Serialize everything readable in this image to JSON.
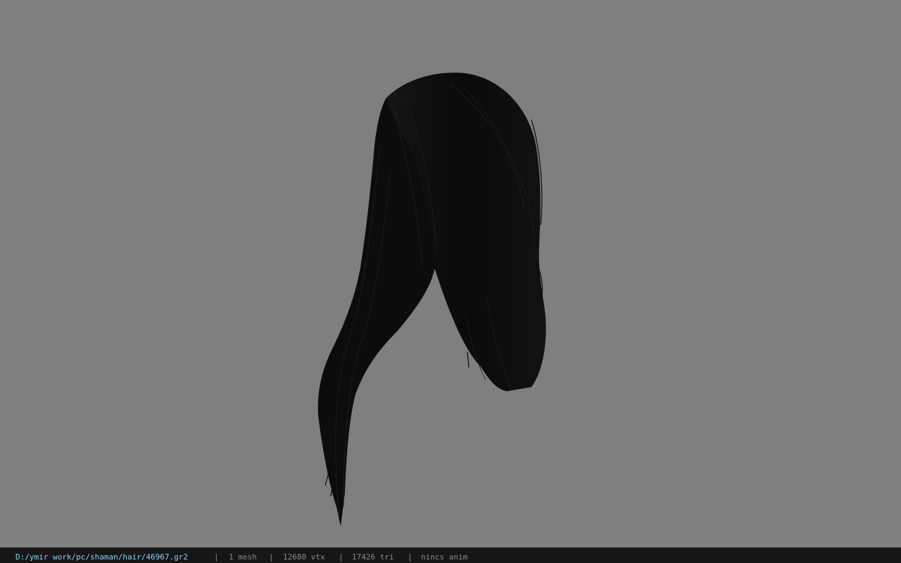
{
  "viewport": {
    "background_color": "#7f7f7f",
    "model_color": "#0b0b0b",
    "model": "hair-mesh"
  },
  "statusbar": {
    "file_path": "D:/ymir work/pc/shaman/hair/46967.gr2",
    "separator": "|",
    "mesh_count": "1 mesh",
    "vertex_count": "12680 vtx",
    "triangle_count": "17426 tri",
    "anim_status": "nincs anim",
    "path_color": "#8fd0ee",
    "background_color": "#161616"
  }
}
